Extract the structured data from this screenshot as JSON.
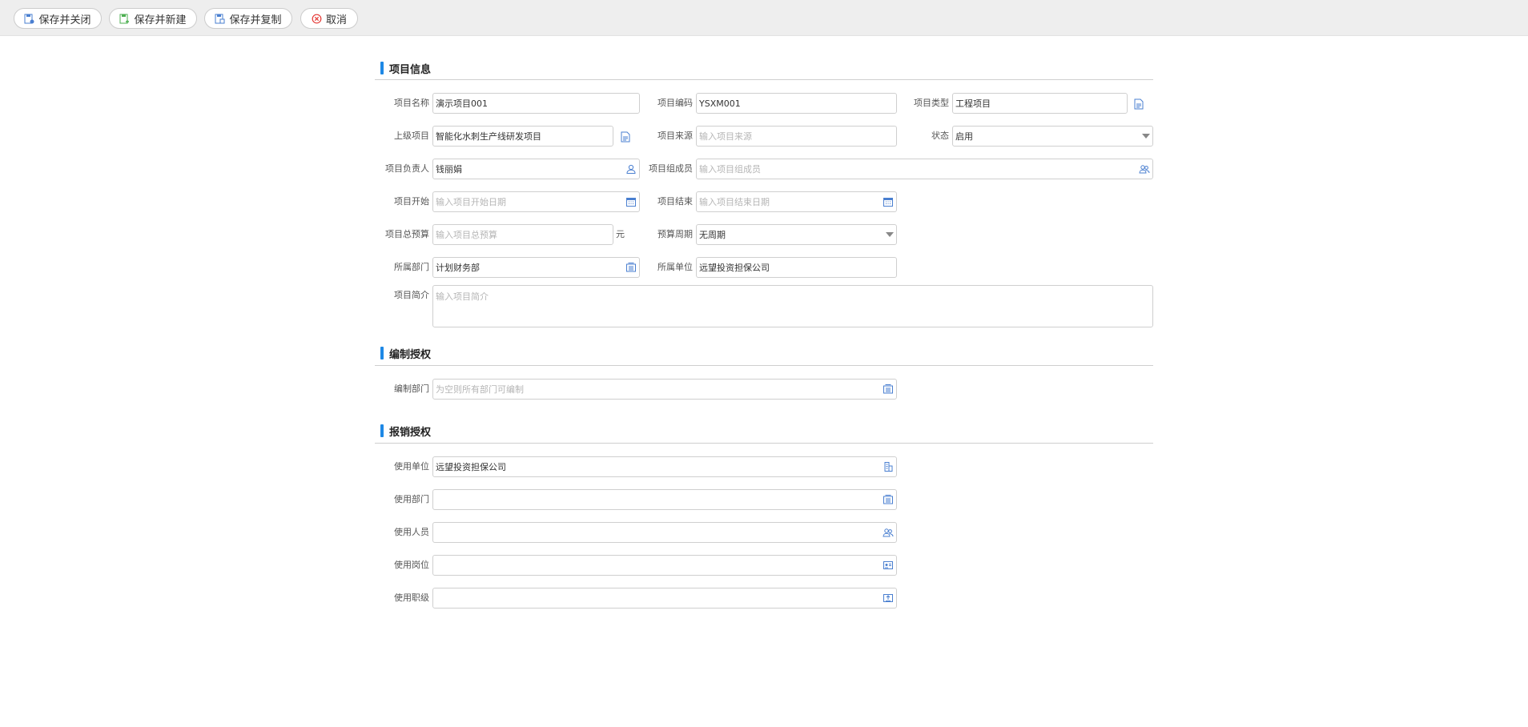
{
  "toolbar": {
    "save_close": "保存并关闭",
    "save_new": "保存并新建",
    "save_copy": "保存并复制",
    "cancel": "取消"
  },
  "sections": {
    "project_info": "项目信息",
    "compile_auth": "编制授权",
    "reimburse_auth": "报销授权"
  },
  "project_info": {
    "name": {
      "label": "项目名称",
      "value": "演示项目001"
    },
    "code": {
      "label": "项目编码",
      "value": "YSXM001"
    },
    "type": {
      "label": "项目类型",
      "value": "工程项目",
      "icon": "document-icon"
    },
    "parent": {
      "label": "上级项目",
      "value": "智能化水刺生产线研发项目",
      "icon": "document-icon"
    },
    "source": {
      "label": "项目来源",
      "placeholder": "输入项目来源"
    },
    "status": {
      "label": "状态",
      "value": "启用"
    },
    "manager": {
      "label": "项目负责人",
      "value": "钱丽娟",
      "icon": "person-icon"
    },
    "members": {
      "label": "项目组成员",
      "placeholder": "输入项目组成员",
      "icon": "people-icon"
    },
    "start": {
      "label": "项目开始",
      "placeholder": "输入项目开始日期",
      "icon": "calendar-icon"
    },
    "end": {
      "label": "项目结束",
      "placeholder": "输入项目结束日期",
      "icon": "calendar-icon"
    },
    "budget": {
      "label": "项目总预算",
      "placeholder": "输入项目总预算",
      "unit": "元"
    },
    "cycle": {
      "label": "预算周期",
      "value": "无周期"
    },
    "dept": {
      "label": "所属部门",
      "value": "计划财务部",
      "icon": "department-icon"
    },
    "unit": {
      "label": "所属单位",
      "value": "远望投资担保公司"
    },
    "intro": {
      "label": "项目简介",
      "placeholder": "输入项目简介"
    }
  },
  "compile_auth": {
    "dept": {
      "label": "编制部门",
      "placeholder": "为空则所有部门可编制",
      "icon": "department-icon"
    }
  },
  "reimburse_auth": {
    "unit": {
      "label": "使用单位",
      "value": "远望投资担保公司",
      "icon": "building-icon"
    },
    "dept": {
      "label": "使用部门",
      "value": "",
      "icon": "department-icon"
    },
    "person": {
      "label": "使用人员",
      "value": "",
      "icon": "people-icon"
    },
    "post": {
      "label": "使用岗位",
      "value": "",
      "icon": "id-card-icon"
    },
    "rank": {
      "label": "使用职级",
      "value": "",
      "icon": "rank-icon"
    }
  },
  "colors": {
    "accent": "#1e88e5",
    "icon": "#4a7fd0",
    "toolbar_bg": "#eeeeee"
  }
}
